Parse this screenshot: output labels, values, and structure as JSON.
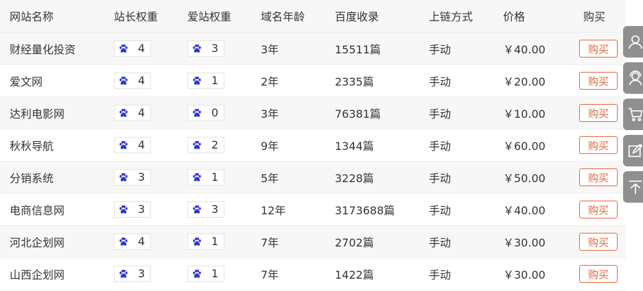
{
  "columns": [
    "网站名称",
    "站长权重",
    "爱站权重",
    "域名年龄",
    "百度收录",
    "上链方式",
    "价格",
    "购买"
  ],
  "rows": [
    {
      "name": "财经量化投资",
      "zz": "4",
      "az": "3",
      "age": "3年",
      "baidu": "15511篇",
      "method": "手动",
      "price": "￥40.00",
      "buy": "购买"
    },
    {
      "name": "爱文网",
      "zz": "4",
      "az": "1",
      "age": "2年",
      "baidu": "2335篇",
      "method": "手动",
      "price": "￥20.00",
      "buy": "购买"
    },
    {
      "name": "达利电影网",
      "zz": "4",
      "az": "0",
      "age": "3年",
      "baidu": "76381篇",
      "method": "手动",
      "price": "￥10.00",
      "buy": "购买"
    },
    {
      "name": "秋秋导航",
      "zz": "4",
      "az": "2",
      "age": "9年",
      "baidu": "1344篇",
      "method": "手动",
      "price": "￥60.00",
      "buy": "购买"
    },
    {
      "name": "分销系统",
      "zz": "3",
      "az": "1",
      "age": "5年",
      "baidu": "3228篇",
      "method": "手动",
      "price": "￥50.00",
      "buy": "购买"
    },
    {
      "name": "电商信息网",
      "zz": "3",
      "az": "3",
      "age": "12年",
      "baidu": "3173688篇",
      "method": "手动",
      "price": "￥40.00",
      "buy": "购买"
    },
    {
      "name": "河北企划网",
      "zz": "4",
      "az": "1",
      "age": "7年",
      "baidu": "2702篇",
      "method": "手动",
      "price": "￥30.00",
      "buy": "购买"
    },
    {
      "name": "山西企划网",
      "zz": "3",
      "az": "1",
      "age": "7年",
      "baidu": "1422篇",
      "method": "手动",
      "price": "￥30.00",
      "buy": "购买"
    }
  ],
  "icons": {
    "weight": "paw-icon"
  },
  "colors": {
    "paw": "#2b37d6",
    "buy_border": "#e86338",
    "sidebar": "#8f8f8f"
  },
  "sidebar": [
    {
      "icon": "user-icon"
    },
    {
      "icon": "support-icon"
    },
    {
      "icon": "cart-icon"
    },
    {
      "icon": "edit-icon"
    },
    {
      "icon": "back-to-top-icon"
    }
  ]
}
